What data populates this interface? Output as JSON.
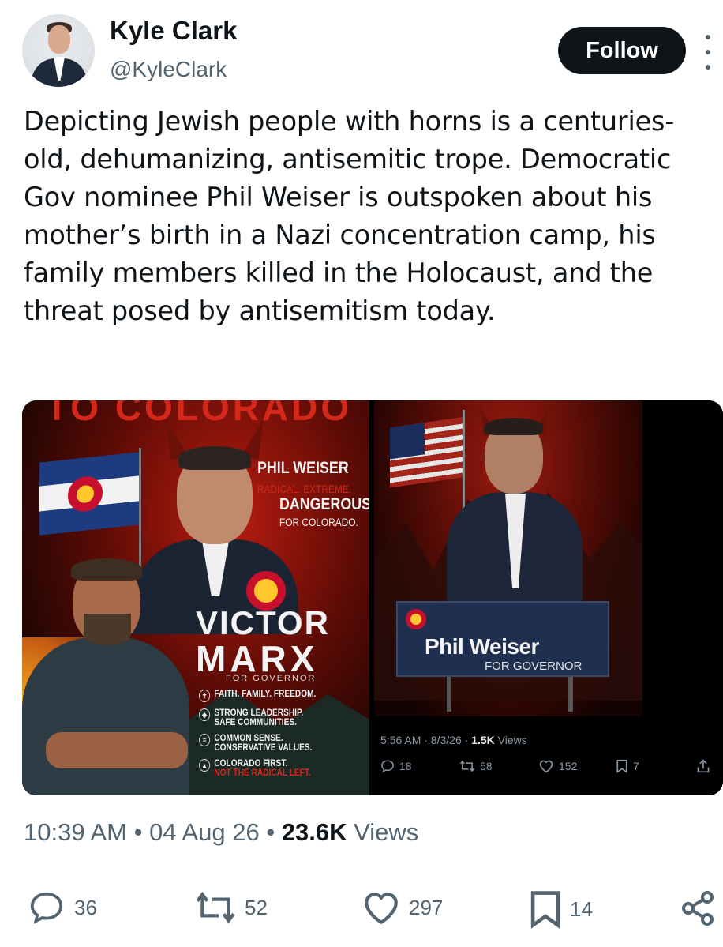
{
  "author": {
    "name": "Kyle Clark",
    "handle": "@KyleClark",
    "follow_label": "Follow"
  },
  "tweet": {
    "text": "Depicting Jewish people with horns is a centuries-old, dehumanizing, antisemitic trope. Democratic Gov nominee Phil Weiser is outspoken about his mother’s birth in a Nazi concentration camp, his family members killed in the Holocaust, and the threat posed by antisemitism today."
  },
  "media_left": {
    "banner_top": "TO COLORADO",
    "pw_name": "PHIL WEISER",
    "pw_sub": "RADICAL. EXTREME.",
    "pw_danger": "DANGEROUS",
    "pw_for": "FOR COLORADO.",
    "victor": "VICTOR",
    "marx": "MARX",
    "for_governor": "FOR GOVERNOR",
    "pillars": [
      {
        "line1": "FAITH. FAMILY. FREEDOM.",
        "line2": "",
        "icon": "cross-icon"
      },
      {
        "line1": "STRONG LEADERSHIP.",
        "line2": "SAFE COMMUNITIES.",
        "icon": "shield-icon"
      },
      {
        "line1": "COMMON SENSE.",
        "line2": "CONSERVATIVE VALUES.",
        "icon": "flag-icon"
      },
      {
        "line1": "COLORADO FIRST.",
        "line2": "NOT THE RADICAL LEFT.",
        "icon": "mountain-icon"
      }
    ]
  },
  "media_right": {
    "podium_name": "Phil Weiser",
    "podium_for": "FOR GOVERNOR",
    "meta_time": "5:56 AM · 8/3/26 · ",
    "meta_views_count": "1.5K",
    "meta_views_label": " Views",
    "replies": "18",
    "reposts": "58",
    "likes": "152",
    "bookmarks": "7"
  },
  "meta": {
    "time": "10:39 AM",
    "sep1": " • ",
    "date": "04 Aug 26",
    "sep2": " • ",
    "views_count": "23.6K",
    "views_label": " Views"
  },
  "actions": {
    "replies": "36",
    "reposts": "52",
    "likes": "297",
    "bookmarks": "14"
  },
  "colors": {
    "text_primary": "#0f1419",
    "text_secondary": "#536471",
    "follow_bg": "#0f1419",
    "poster_red": "#d4281b"
  }
}
